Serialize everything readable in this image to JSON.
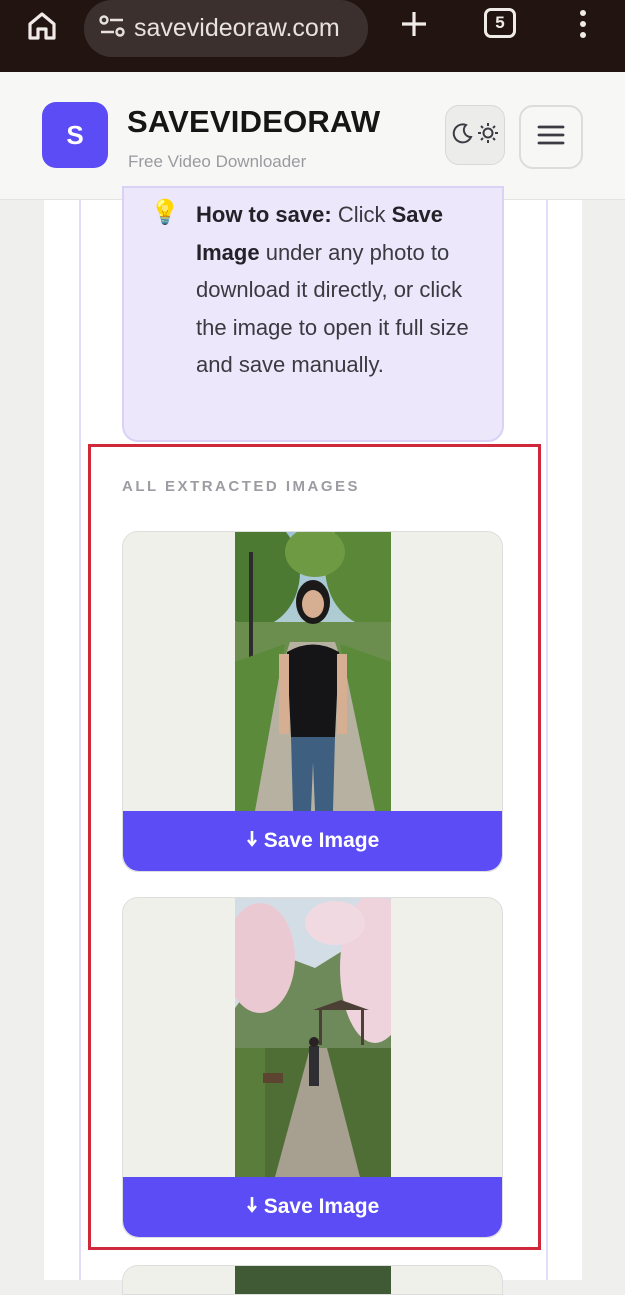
{
  "browser": {
    "url": "savevideoraw.com",
    "tab_count": "5",
    "icons": [
      "home-icon",
      "site-settings-icon",
      "new-tab-icon",
      "tab-switcher-icon",
      "more-options-icon"
    ]
  },
  "header": {
    "logo_letter": "S",
    "brand_name": "SAVEVIDEORAW",
    "tagline": "Free Video Downloader",
    "theme_toggle_icons": [
      "moon-icon",
      "sun-icon"
    ],
    "menu_icon": "hamburger-menu-icon"
  },
  "howto": {
    "icon": "lightbulb-icon",
    "lead": "How to save:",
    "part1": " Click ",
    "bold_action": "Save Image",
    "part2": " under any photo to download it directly, or click the image to open it full size and save manually."
  },
  "gallery": {
    "section_label": "ALL EXTRACTED IMAGES",
    "images": [
      {
        "description": "woman-in-park-photo",
        "save_label": "Save Image",
        "save_icon": "download-arrow-icon"
      },
      {
        "description": "cherry-blossom-path-photo",
        "save_label": "Save Image",
        "save_icon": "download-arrow-icon"
      }
    ]
  },
  "colors": {
    "accent": "#5b4cf5",
    "browser_bar": "#221410",
    "highlight_outline": "#d0283b",
    "howto_bg": "#ece7fb"
  }
}
